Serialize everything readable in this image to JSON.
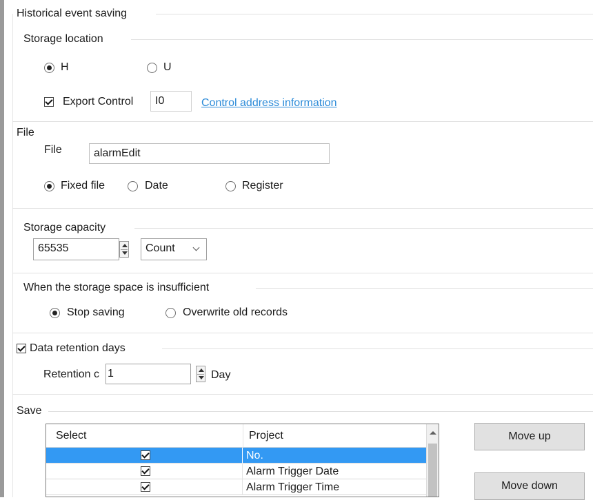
{
  "historical_event_saving": {
    "title": "Historical event saving"
  },
  "storage_location": {
    "title": "Storage location",
    "options": [
      "H",
      "U"
    ],
    "selected": "H",
    "export_control": {
      "label": "Export Control",
      "checked": true,
      "value": "I0",
      "link_text": "Control address information"
    }
  },
  "file": {
    "title": "File",
    "field_label": "File",
    "field_value": "alarmEdit",
    "options": [
      "Fixed file",
      "Date",
      "Register"
    ],
    "selected": "Fixed file"
  },
  "storage_capacity": {
    "title": "Storage capacity",
    "value": "65535",
    "unit_selected": "Count"
  },
  "insufficient_space": {
    "title": "When the storage space is insufficient",
    "options": [
      "Stop saving",
      "Overwrite old records"
    ],
    "selected": "Stop saving"
  },
  "data_retention": {
    "title": "Data retention days",
    "checked": true,
    "label": "Retention c",
    "value": "1",
    "unit": "Day"
  },
  "save": {
    "title": "Save",
    "columns": [
      "Select",
      "Project"
    ],
    "rows": [
      {
        "checked": true,
        "project": "No.",
        "selected": true
      },
      {
        "checked": true,
        "project": "Alarm Trigger Date",
        "selected": false
      },
      {
        "checked": true,
        "project": "Alarm Trigger Time",
        "selected": false
      }
    ],
    "move_up_label": "Move up",
    "move_down_label": "Move down"
  },
  "colors": {
    "link": "#2a8ad8",
    "selection": "#3399f3"
  },
  "icons": [
    "radio-icon",
    "checkbox-icon",
    "spinner-icon",
    "dropdown-chevron-icon",
    "scroll-up-arrow-icon"
  ]
}
